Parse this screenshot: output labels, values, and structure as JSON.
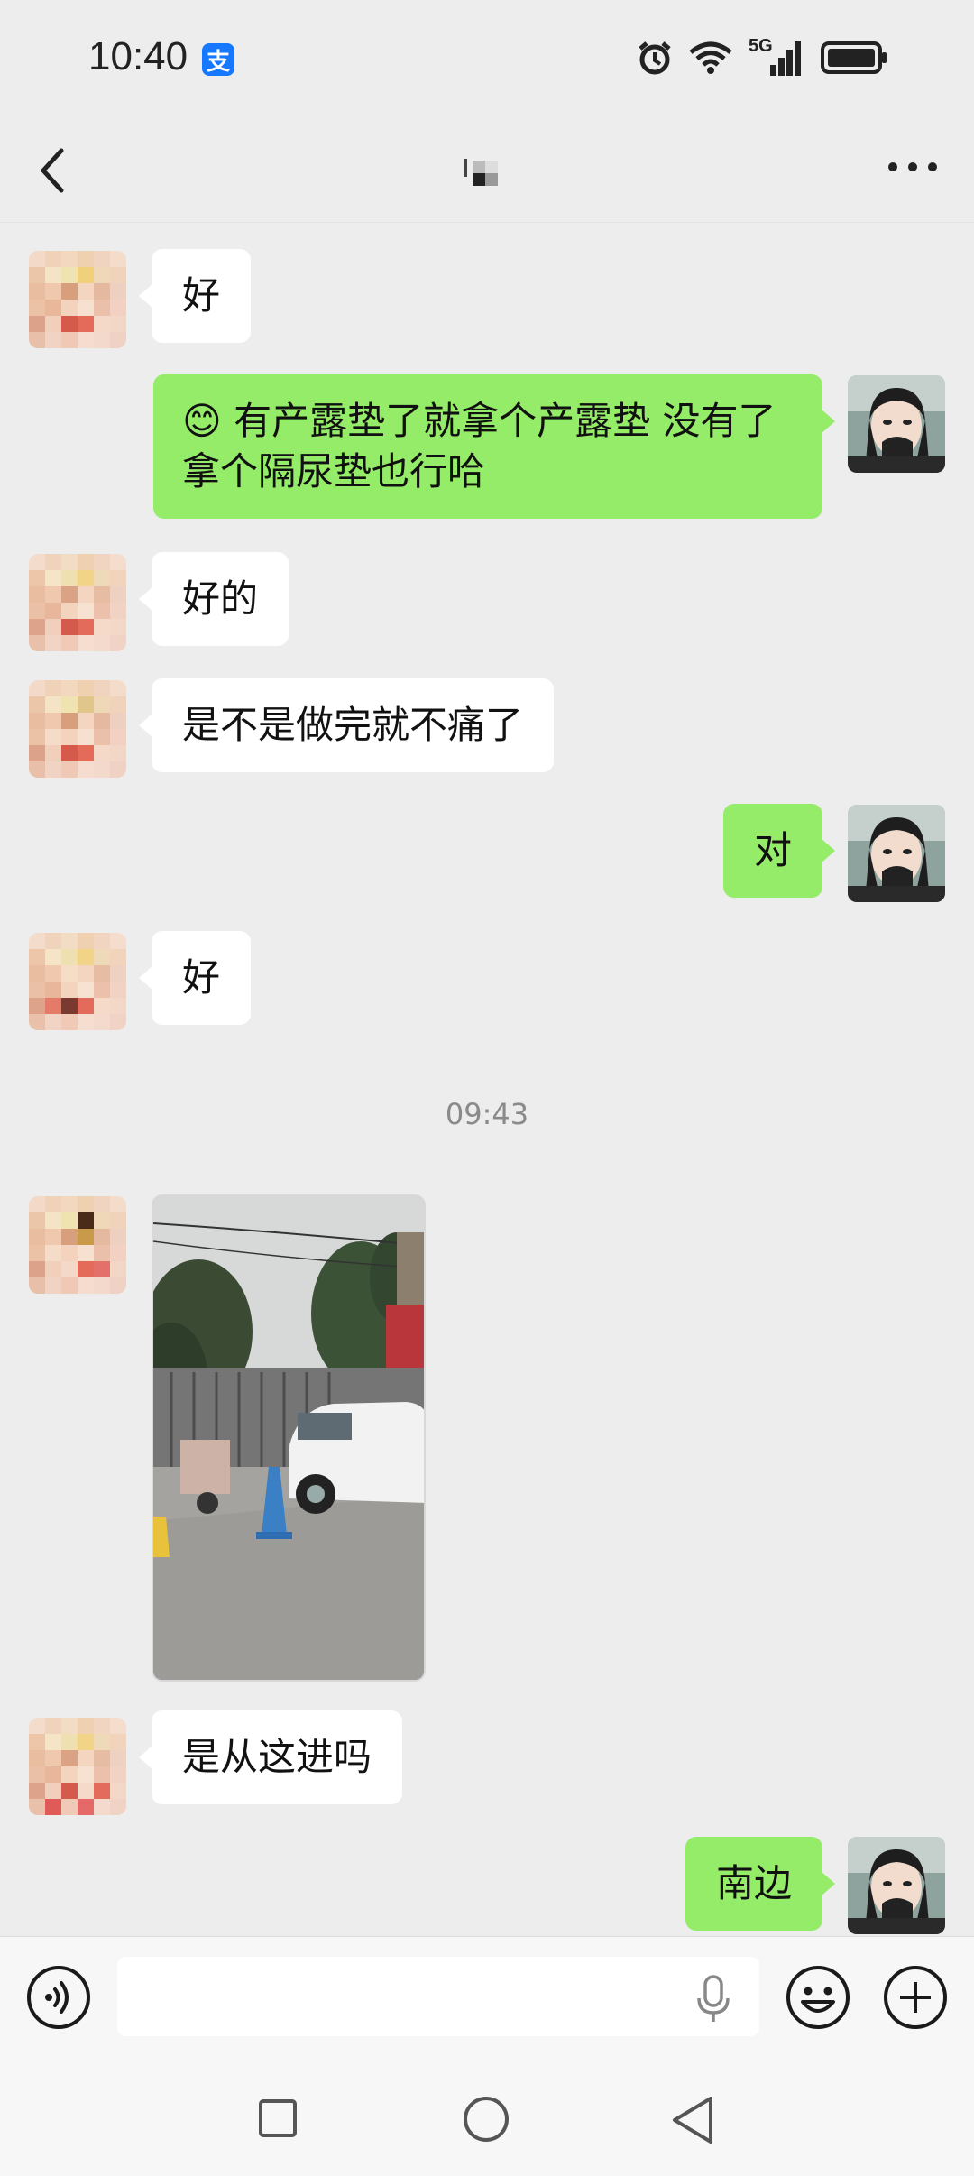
{
  "status_bar": {
    "time": "10:40",
    "app_badge": "支",
    "network": "5G",
    "icons": [
      "alarm-icon",
      "wifi-icon",
      "signal-icon",
      "battery-icon"
    ]
  },
  "title_bar": {
    "back_icon": "chevron-left-icon",
    "more_icon": "more-dots-icon"
  },
  "messages": [
    {
      "side": "left",
      "text": "好"
    },
    {
      "side": "right",
      "emoji": "😊",
      "text": " 有产露垫了就拿个产露垫 没有了拿个隔尿垫也行哈"
    },
    {
      "side": "left",
      "text": "好的"
    },
    {
      "side": "left",
      "text": "是不是做完就不痛了"
    },
    {
      "side": "right",
      "text": "对"
    },
    {
      "side": "left",
      "text": "好"
    },
    {
      "type": "timestamp",
      "text": "09:43"
    },
    {
      "side": "left",
      "type": "image",
      "alt": "photo-message"
    },
    {
      "side": "left",
      "text": "是从这进吗"
    },
    {
      "side": "right",
      "text": "南边"
    }
  ],
  "input_bar": {
    "placeholder": "",
    "icons": [
      "voice-icon",
      "mic-icon",
      "emoji-icon",
      "plus-icon"
    ]
  },
  "nav_bar": {
    "icons": [
      "recents-square-icon",
      "home-circle-icon",
      "back-triangle-icon"
    ]
  },
  "colors": {
    "background": "#ededed",
    "bubble_self": "#95ec69",
    "bubble_other": "#ffffff",
    "timestamp": "#8a8a8a",
    "app_badge": "#1677ff"
  }
}
